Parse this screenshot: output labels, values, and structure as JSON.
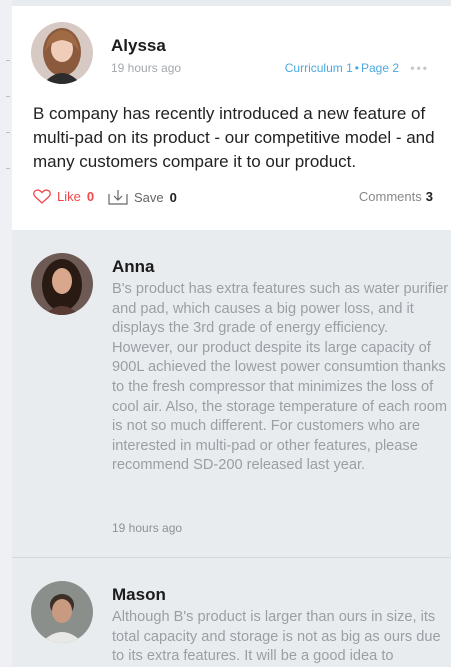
{
  "post": {
    "author": "Alyssa",
    "time": "19 hours ago",
    "curriculum_label": "Curriculum",
    "curriculum_number": "1",
    "page_label": "Page",
    "page_number": "2",
    "more_icon": "more-dots-icon",
    "text": "B company has recently introduced a new feature of multi-pad on its product - our competitive model - and many customers compare it to our product.",
    "like_label": "Like",
    "like_count": "0",
    "save_label": "Save",
    "save_count": "0",
    "comments_label": "Comments",
    "comments_count": "3",
    "accent_color": "#f0484c",
    "link_color": "#4aa9e0"
  },
  "comments": [
    {
      "author": "Anna",
      "text": "B's product has extra features such as water purifier and pad, which causes a big power loss, and it displays the 3rd grade of energy efficiency. However, our product despite its large capacity of 900L achieved the lowest power consumtion thanks to the fresh compressor that minimizes the loss of cool air. Also, the storage temperature of each room is not so much different. For customers who are interested in multi-pad or other features, please recommend SD-200 released last year.",
      "time": "19 hours ago"
    },
    {
      "author": "Mason",
      "text": "Although B's product is larger than ours in size, its total capacity and storage is not as big as ours due to its extra features. It will be a good idea to",
      "time": ""
    }
  ]
}
